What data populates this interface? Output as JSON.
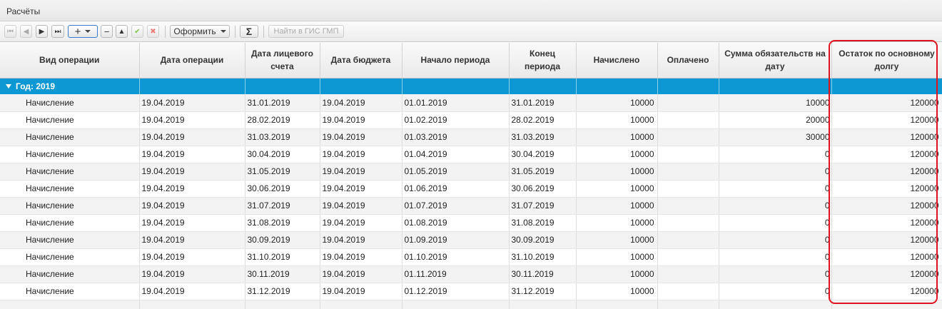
{
  "panel": {
    "title": "Расчёты"
  },
  "toolbar": {
    "first_icon": "⏮",
    "prev_icon": "◀",
    "next_icon": "▶",
    "last_icon": "⏭",
    "add_label": "+",
    "remove_label": "−",
    "up_label": "▲",
    "check_label": "✔",
    "cancel_label": "✖",
    "format_label": "Оформить",
    "sum_label": "Σ",
    "gis_label": "Найти в ГИС ГМП"
  },
  "table": {
    "columns": [
      "Вид операции",
      "Дата операции",
      "Дата лицевого счета",
      "Дата бюджета",
      "Начало периода",
      "Конец периода",
      "Начислено",
      "Оплачено",
      "Сумма обязательств на дату",
      "Остаток по основному долгу"
    ],
    "group_label": "Год: 2019",
    "rows": [
      [
        "Начисление",
        "19.04.2019",
        "31.01.2019",
        "19.04.2019",
        "01.01.2019",
        "31.01.2019",
        "10000",
        "",
        "10000",
        "120000"
      ],
      [
        "Начисление",
        "19.04.2019",
        "28.02.2019",
        "19.04.2019",
        "01.02.2019",
        "28.02.2019",
        "10000",
        "",
        "20000",
        "120000"
      ],
      [
        "Начисление",
        "19.04.2019",
        "31.03.2019",
        "19.04.2019",
        "01.03.2019",
        "31.03.2019",
        "10000",
        "",
        "30000",
        "120000"
      ],
      [
        "Начисление",
        "19.04.2019",
        "30.04.2019",
        "19.04.2019",
        "01.04.2019",
        "30.04.2019",
        "10000",
        "",
        "0",
        "120000"
      ],
      [
        "Начисление",
        "19.04.2019",
        "31.05.2019",
        "19.04.2019",
        "01.05.2019",
        "31.05.2019",
        "10000",
        "",
        "0",
        "120000"
      ],
      [
        "Начисление",
        "19.04.2019",
        "30.06.2019",
        "19.04.2019",
        "01.06.2019",
        "30.06.2019",
        "10000",
        "",
        "0",
        "120000"
      ],
      [
        "Начисление",
        "19.04.2019",
        "31.07.2019",
        "19.04.2019",
        "01.07.2019",
        "31.07.2019",
        "10000",
        "",
        "0",
        "120000"
      ],
      [
        "Начисление",
        "19.04.2019",
        "31.08.2019",
        "19.04.2019",
        "01.08.2019",
        "31.08.2019",
        "10000",
        "",
        "0",
        "120000"
      ],
      [
        "Начисление",
        "19.04.2019",
        "30.09.2019",
        "19.04.2019",
        "01.09.2019",
        "30.09.2019",
        "10000",
        "",
        "0",
        "120000"
      ],
      [
        "Начисление",
        "19.04.2019",
        "31.10.2019",
        "19.04.2019",
        "01.10.2019",
        "31.10.2019",
        "10000",
        "",
        "0",
        "120000"
      ],
      [
        "Начисление",
        "19.04.2019",
        "30.11.2019",
        "19.04.2019",
        "01.11.2019",
        "30.11.2019",
        "10000",
        "",
        "0",
        "120000"
      ],
      [
        "Начисление",
        "19.04.2019",
        "31.12.2019",
        "19.04.2019",
        "01.12.2019",
        "31.12.2019",
        "10000",
        "",
        "0",
        "120000"
      ]
    ]
  },
  "colors": {
    "group_bg": "#0d98d4",
    "highlight": "#e0141e"
  }
}
